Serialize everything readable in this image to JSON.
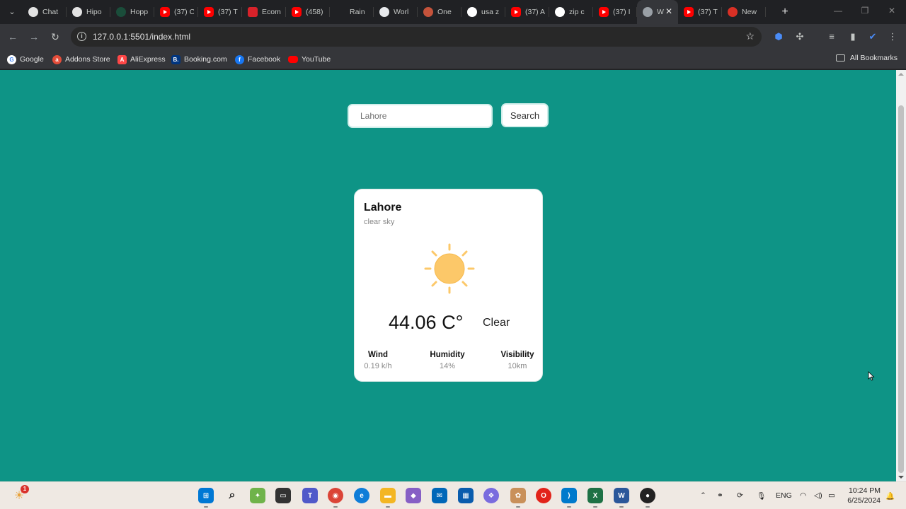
{
  "browser": {
    "tabs": [
      {
        "icon": "chat-icon",
        "title": "Chat",
        "type": "chat"
      },
      {
        "icon": "github-icon",
        "title": "Hipo",
        "type": "gh"
      },
      {
        "icon": "hoppscotch-icon",
        "title": "Hopp",
        "type": "hop"
      },
      {
        "icon": "youtube-icon",
        "title": "(37) C",
        "type": "yt"
      },
      {
        "icon": "youtube-icon",
        "title": "(37) T",
        "type": "yt"
      },
      {
        "icon": "fs-icon",
        "title": "Ecom",
        "type": "fs"
      },
      {
        "icon": "youtube-icon",
        "title": "(458)",
        "type": "yt"
      },
      {
        "icon": "vue-icon",
        "title": "Rain",
        "type": "rain"
      },
      {
        "icon": "world-icon",
        "title": "Worl",
        "type": "world"
      },
      {
        "icon": "one-icon",
        "title": "One",
        "type": "one"
      },
      {
        "icon": "google-icon",
        "title": "usa z",
        "type": "g"
      },
      {
        "icon": "youtube-icon",
        "title": "(37) A",
        "type": "yt"
      },
      {
        "icon": "google-icon",
        "title": "zip c",
        "type": "g"
      },
      {
        "icon": "youtube-icon",
        "title": "(37) I",
        "type": "yt"
      },
      {
        "icon": "globe-icon",
        "title": "W",
        "type": "globe",
        "active": true
      },
      {
        "icon": "youtube-icon",
        "title": "(37) T",
        "type": "yt"
      },
      {
        "icon": "new-icon",
        "title": "New",
        "type": "new"
      }
    ],
    "url": "127.0.0.1:5501/index.html",
    "bookmarks": [
      {
        "label": "Google",
        "type": "google",
        "glyph": "G"
      },
      {
        "label": "Addons Store",
        "type": "addons",
        "glyph": "a"
      },
      {
        "label": "AliExpress",
        "type": "ali",
        "glyph": "A"
      },
      {
        "label": "Booking.com",
        "type": "booking",
        "glyph": "B."
      },
      {
        "label": "Facebook",
        "type": "fb",
        "glyph": "f"
      },
      {
        "label": "YouTube",
        "type": "yt",
        "glyph": ""
      }
    ],
    "all_bookmarks": "All Bookmarks"
  },
  "app": {
    "search": {
      "value": "Lahore",
      "button": "Search"
    },
    "weather": {
      "city": "Lahore",
      "description": "clear sky",
      "icon": "sun-icon",
      "temperature": "44.06 C°",
      "condition": "Clear",
      "stats": [
        {
          "label": "Wind",
          "value": "0.19 k/h"
        },
        {
          "label": "Humidity",
          "value": "14%"
        },
        {
          "label": "Visibility",
          "value": "10km"
        }
      ]
    },
    "colors": {
      "background": "#0e9486",
      "card": "#ffffff",
      "sun": "#fcc869"
    }
  },
  "taskbar": {
    "notification_count": "1",
    "language": "ENG",
    "time": "10:24 PM",
    "date": "6/25/2024"
  }
}
